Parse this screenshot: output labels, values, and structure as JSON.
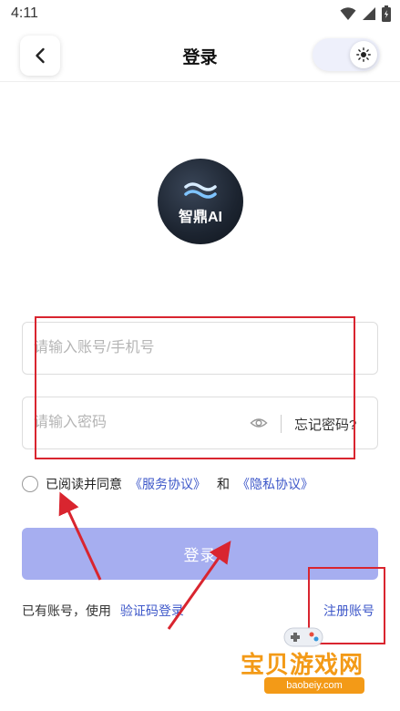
{
  "status_bar": {
    "time": "4:11",
    "icons": [
      "wifi-icon",
      "signal-icon",
      "battery-icon"
    ]
  },
  "header": {
    "title": "登录",
    "back_icon": "chevron-left-icon",
    "theme_icon": "sun-icon"
  },
  "logo": {
    "text": "智鼎AI"
  },
  "form": {
    "account_placeholder": "请输入账号/手机号",
    "password_placeholder": "请输入密码",
    "forgot_password": "忘记密码?",
    "eye_icon": "eye-icon"
  },
  "agreement": {
    "text": "已阅读并同意",
    "service_link": "《服务协议》",
    "and": "和",
    "privacy_link": "《隐私协议》",
    "checked": false
  },
  "login_button": {
    "label": "登录"
  },
  "alt_login": {
    "prefix": "已有账号，使用",
    "sms_link": "验证码登录",
    "register_link": "注册账号"
  },
  "watermark": {
    "text": "宝贝游戏网",
    "url": "baobeiy.com"
  },
  "colors": {
    "accent": "#3d57c9",
    "button_bg": "#a6aef0",
    "annotation": "#d9252f",
    "watermark": "#f39a17"
  }
}
